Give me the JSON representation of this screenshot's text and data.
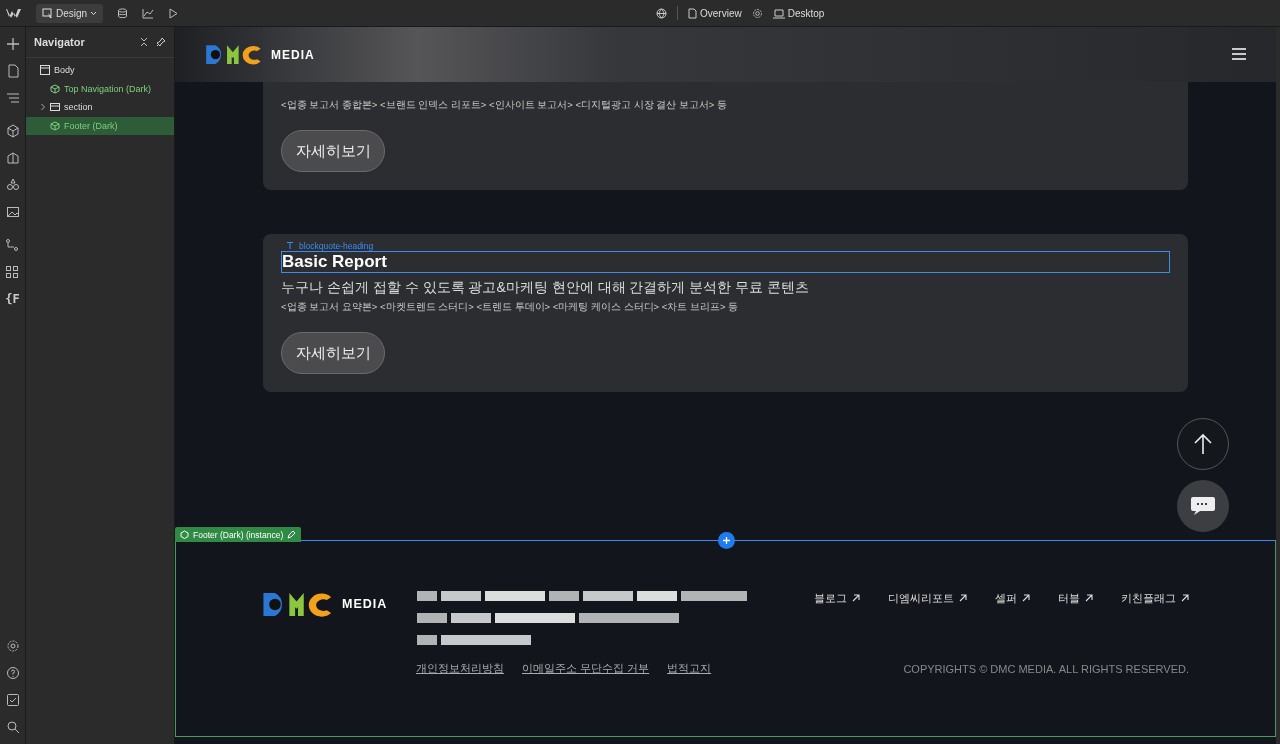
{
  "toolbar": {
    "mode": "Design",
    "page": "Overview",
    "breakpoint": "Desktop"
  },
  "rail": {
    "label": "{F"
  },
  "navigator": {
    "title": "Navigator",
    "tree": [
      {
        "label": "Body",
        "kind": "body",
        "selected": false,
        "children": [
          {
            "label": "Top Navigation (Dark)",
            "kind": "component",
            "selected": false
          },
          {
            "label": "section",
            "kind": "section",
            "selected": false,
            "expanded": false
          },
          {
            "label": "Footer (Dark)",
            "kind": "component",
            "selected": true
          }
        ]
      }
    ]
  },
  "site": {
    "logo_text": "MEDIA",
    "cards": [
      {
        "description": "<업종 보고서 종합본> <브랜드 인덱스 리포트> <인사이트 보고서> <디지털광고 시장 결산 보고서> 등",
        "button": "자세히보기"
      },
      {
        "element_label": "blockquote-heading",
        "title": "Basic Report",
        "subtitle": "누구나 손쉽게 접할 수 있도록 광고&마케팅 현안에 대해 간결하게 분석한 무료 콘텐츠",
        "description": "<업종 보고서 요약본> <마켓트렌드 스터디> <트렌드 투데이> <마케팅 케이스 스터디> <차트 브리프> 등",
        "button": "자세히보기"
      }
    ],
    "footer_tag": "Footer (Dark) (instance)",
    "footer": {
      "logo_text": "MEDIA",
      "links": [
        "블로그",
        "디엠씨리포트",
        "셀퍼",
        "터블",
        "키친플래그"
      ],
      "policies": [
        "개인정보처리방침",
        "이메일주소 무단수집 거부",
        "법적고지"
      ],
      "copyright": "COPYRIGHTS © DMC MEDIA. ALL RIGHTS RESERVED."
    }
  }
}
